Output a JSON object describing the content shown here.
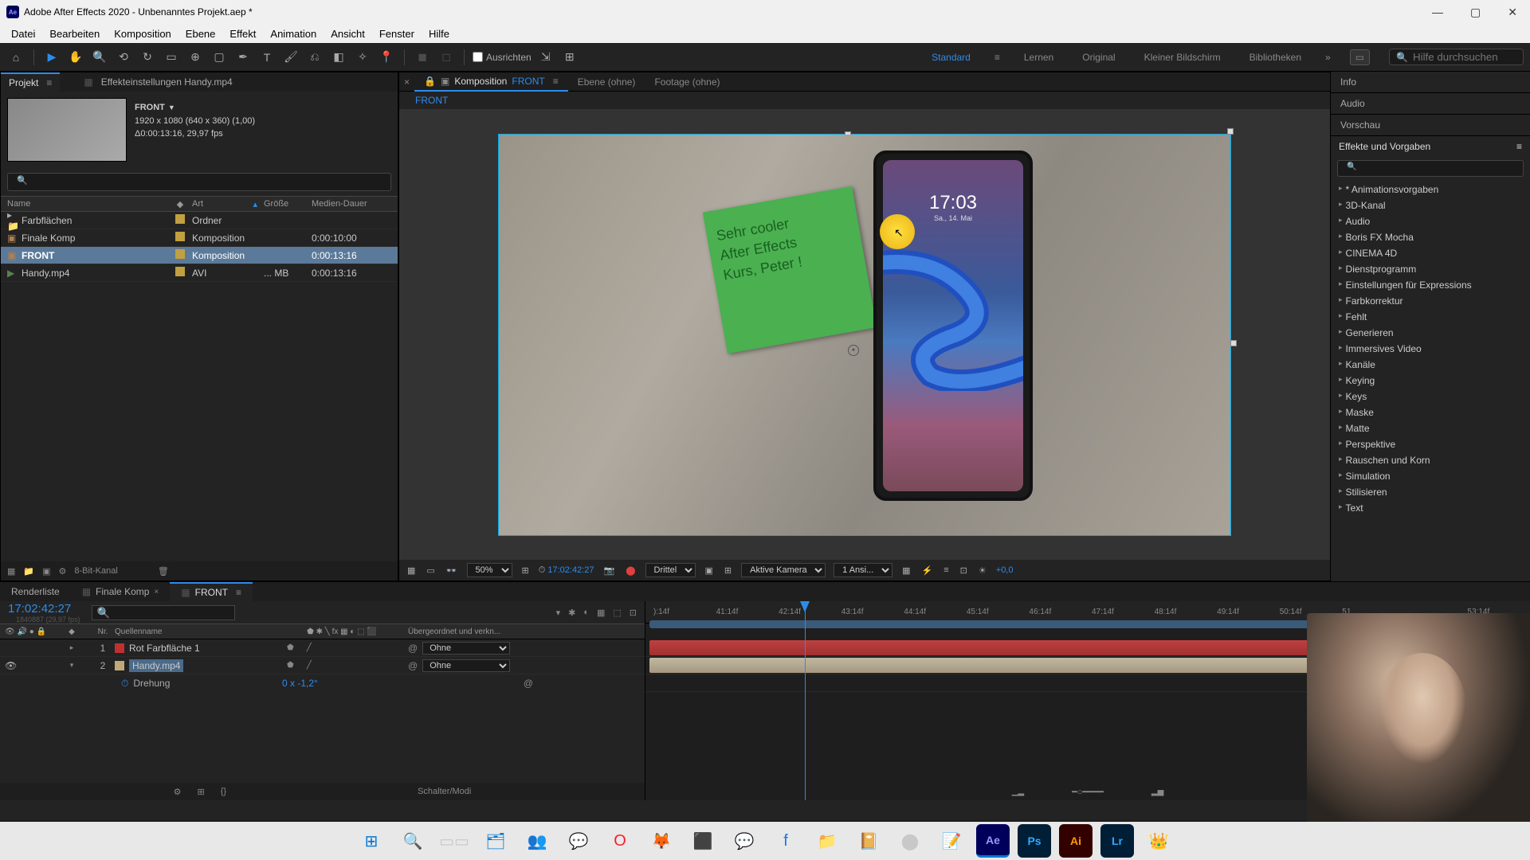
{
  "titlebar": {
    "app_title": "Adobe After Effects 2020 - Unbenanntes Projekt.aep *"
  },
  "menu": {
    "items": [
      "Datei",
      "Bearbeiten",
      "Komposition",
      "Ebene",
      "Effekt",
      "Animation",
      "Ansicht",
      "Fenster",
      "Hilfe"
    ]
  },
  "toolbar": {
    "snap_label": "Ausrichten",
    "workspaces": {
      "active": "Standard",
      "others": [
        "Lernen",
        "Original",
        "Kleiner Bildschirm",
        "Bibliotheken"
      ]
    },
    "search_placeholder": "Hilfe durchsuchen"
  },
  "project_panel": {
    "tabs": {
      "project": "Projekt",
      "effect_controls": "Effekteinstellungen  Handy.mp4"
    },
    "selected_name": "FRONT",
    "meta_line1": "1920 x 1080 (640 x 360) (1,00)",
    "meta_line2": "Δ0:00:13:16, 29,97 fps",
    "columns": {
      "name": "Name",
      "art": "Art",
      "size": "Größe",
      "duration": "Medien-Dauer"
    },
    "items": [
      {
        "name": "Farbflächen",
        "type": "Ordner",
        "label_color": "#c0a040",
        "size": "",
        "duration": ""
      },
      {
        "name": "Finale Komp",
        "type": "Komposition",
        "label_color": "#c0a040",
        "size": "",
        "duration": "0:00:10:00"
      },
      {
        "name": "FRONT",
        "type": "Komposition",
        "label_color": "#c0a040",
        "size": "",
        "duration": "0:00:13:16",
        "selected": true
      },
      {
        "name": "Handy.mp4",
        "type": "AVI",
        "label_color": "#c0a040",
        "size": "... MB",
        "duration": "0:00:13:16"
      }
    ],
    "footer_bpc": "8-Bit-Kanal"
  },
  "composition": {
    "tab_prefix": "Komposition",
    "tab_name": "FRONT",
    "tab_layer": "Ebene  (ohne)",
    "tab_footage": "Footage  (ohne)",
    "breadcrumb": "FRONT",
    "phone_time": "17:03",
    "phone_date": "Sa., 14. Mai",
    "sticky_lines": [
      "Sehr cooler",
      "After Effects",
      "Kurs, Peter !"
    ]
  },
  "viewer_footer": {
    "zoom": "50%",
    "timecode": "17:02:42:27",
    "resolution": "Drittel",
    "camera": "Aktive Kamera",
    "views": "1 Ansi...",
    "exposure": "+0,0"
  },
  "right_panels": {
    "info": "Info",
    "audio": "Audio",
    "preview": "Vorschau",
    "effects_title": "Effekte und Vorgaben",
    "effects_items": [
      "* Animationsvorgaben",
      "3D-Kanal",
      "Audio",
      "Boris FX Mocha",
      "CINEMA 4D",
      "Dienstprogramm",
      "Einstellungen für Expressions",
      "Farbkorrektur",
      "Fehlt",
      "Generieren",
      "Immersives Video",
      "Kanäle",
      "Keying",
      "Keys",
      "Maske",
      "Matte",
      "Perspektive",
      "Rauschen und Korn",
      "Simulation",
      "Stilisieren",
      "Text"
    ]
  },
  "timeline": {
    "tabs": {
      "render": "Renderliste",
      "finale": "Finale Komp",
      "front": "FRONT"
    },
    "timecode": "17:02:42:27",
    "sub_timecode": "1840887 (29,97 fps)",
    "headers": {
      "nr": "Nr.",
      "source_name": "Quellenname",
      "parent": "Übergeordnet und verkn..."
    },
    "layers": [
      {
        "nr": "1",
        "name": "Rot Farbfläche 1",
        "label_color": "#c03030",
        "parent": "Ohne",
        "visible": false
      },
      {
        "nr": "2",
        "name": "Handy.mp4",
        "label_color": "#c0a878",
        "parent": "Ohne",
        "visible": true,
        "selected": true
      }
    ],
    "property": {
      "name": "Drehung",
      "value": "0 x -1,2°"
    },
    "ruler_ticks": [
      "):14f",
      "41:14f",
      "42:14f",
      "43:14f",
      "44:14f",
      "45:14f",
      "46:14f",
      "47:14f",
      "48:14f",
      "49:14f",
      "50:14f",
      "51",
      "",
      "53:14f"
    ],
    "footer_label": "Schalter/Modi"
  },
  "taskbar": {
    "icons": [
      "windows",
      "search",
      "task-view",
      "explorer",
      "teams",
      "whatsapp",
      "opera",
      "firefox",
      "app1",
      "messenger",
      "facebook",
      "files",
      "app2",
      "obs",
      "notepad",
      "after-effects",
      "photoshop",
      "illustrator",
      "lightroom",
      "app3"
    ]
  }
}
